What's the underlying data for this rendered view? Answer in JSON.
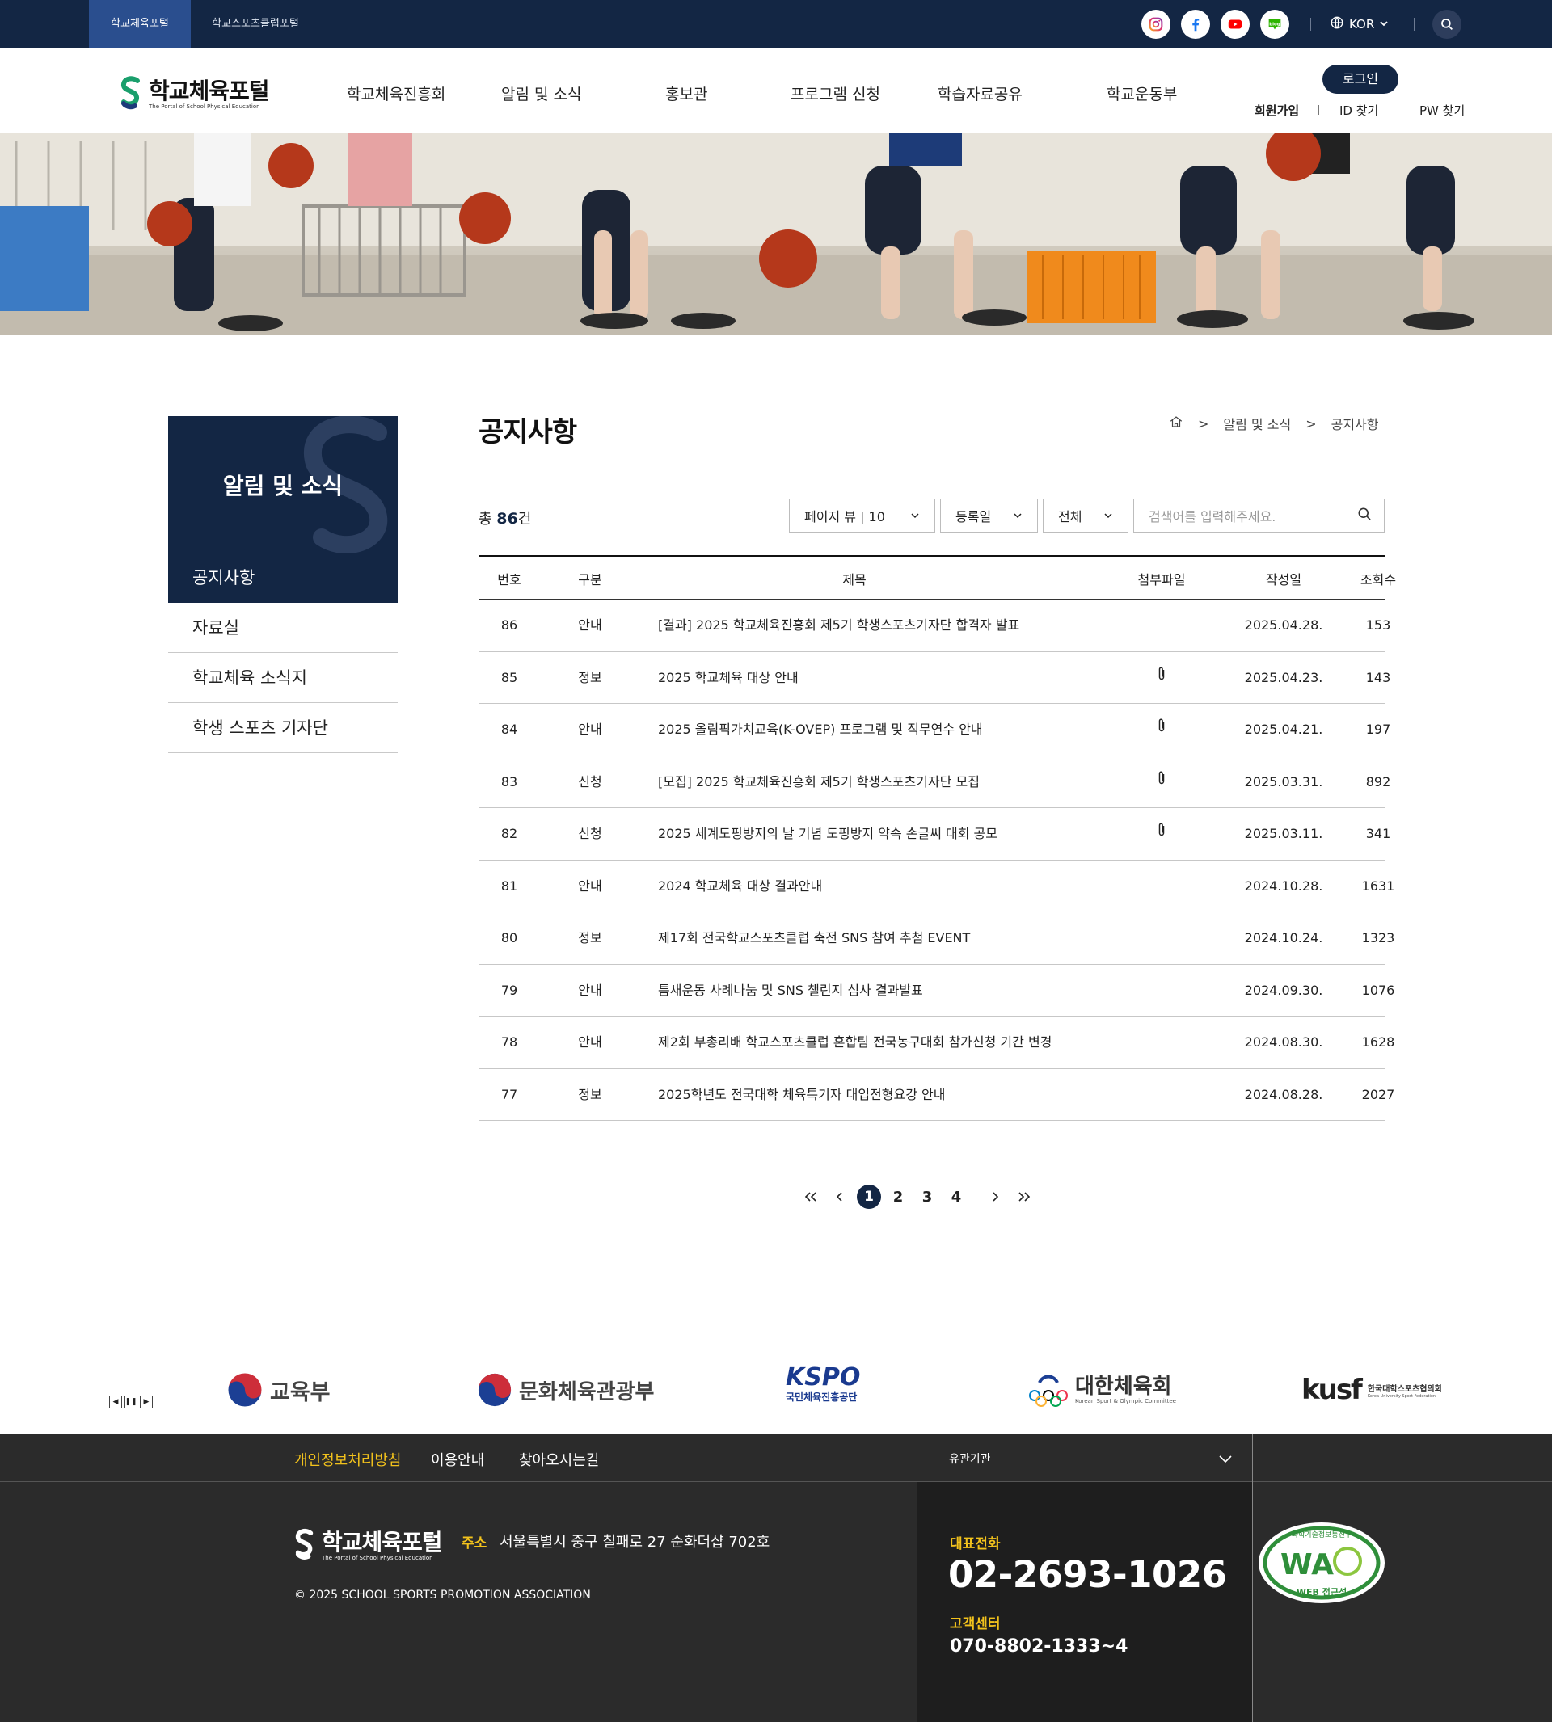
{
  "topbar": {
    "portal_tabs": [
      "학교체육포털",
      "학교스포츠클럽포털"
    ],
    "sns": [
      "instagram-icon",
      "facebook-icon",
      "youtube-icon",
      "blog-icon"
    ],
    "lang": "KOR"
  },
  "header": {
    "logo_title": "학교체육포털",
    "logo_sub": "The Portal of School Physical Education",
    "gnb": [
      "학교체육진흥회",
      "알림 및 소식",
      "홍보관",
      "프로그램 신청",
      "학습자료공유",
      "학교운동부"
    ],
    "login": "로그인",
    "util": [
      "회원가입",
      "ID 찾기",
      "PW 찾기"
    ]
  },
  "side": {
    "title": "알림 및 소식",
    "items": [
      "공지사항",
      "자료실",
      "학교체육 소식지",
      "학생 스포츠 기자단"
    ]
  },
  "content": {
    "title": "공지사항",
    "breadcrumb": [
      "알림 및 소식",
      "공지사항"
    ],
    "total_prefix": "총",
    "total_count": "86",
    "total_suffix": "건",
    "filters": {
      "page_view": "페이지 뷰  |  10",
      "sort": "등록일",
      "category": "전체",
      "search_placeholder": "검색어를 입력해주세요."
    },
    "columns": [
      "번호",
      "구분",
      "제목",
      "첨부파일",
      "작성일",
      "조회수"
    ],
    "rows": [
      {
        "no": "86",
        "cat": "안내",
        "title": "[결과] 2025 학교체육진흥회 제5기 학생스포츠기자단 합격자 발표",
        "file": false,
        "date": "2025.04.28.",
        "views": "153"
      },
      {
        "no": "85",
        "cat": "정보",
        "title": "2025 학교체육 대상 안내",
        "file": true,
        "date": "2025.04.23.",
        "views": "143"
      },
      {
        "no": "84",
        "cat": "안내",
        "title": "2025 올림픽가치교육(K-OVEP) 프로그램 및 직무연수 안내",
        "file": true,
        "date": "2025.04.21.",
        "views": "197"
      },
      {
        "no": "83",
        "cat": "신청",
        "title": "[모집] 2025 학교체육진흥회 제5기 학생스포츠기자단 모집",
        "file": true,
        "date": "2025.03.31.",
        "views": "892"
      },
      {
        "no": "82",
        "cat": "신청",
        "title": "2025 세계도핑방지의 날 기념 도핑방지 약속 손글씨 대회 공모",
        "file": true,
        "date": "2025.03.11.",
        "views": "341"
      },
      {
        "no": "81",
        "cat": "안내",
        "title": "2024 학교체육 대상 결과안내",
        "file": false,
        "date": "2024.10.28.",
        "views": "1631"
      },
      {
        "no": "80",
        "cat": "정보",
        "title": "제17회 전국학교스포츠클럽 축전 SNS 참여 추첨 EVENT",
        "file": false,
        "date": "2024.10.24.",
        "views": "1323"
      },
      {
        "no": "79",
        "cat": "안내",
        "title": "틈새운동 사례나눔 및 SNS 챌린지 심사 결과발표",
        "file": false,
        "date": "2024.09.30.",
        "views": "1076"
      },
      {
        "no": "78",
        "cat": "안내",
        "title": "제2회 부총리배 학교스포츠클럽 혼합팀 전국농구대회 참가신청 기간 변경",
        "file": false,
        "date": "2024.08.30.",
        "views": "1628"
      },
      {
        "no": "77",
        "cat": "정보",
        "title": "2025학년도 전국대학 체육특기자 대입전형요강 안내",
        "file": false,
        "date": "2024.08.28.",
        "views": "2027"
      }
    ],
    "pages": [
      "1",
      "2",
      "3",
      "4"
    ],
    "current_page": "1"
  },
  "partners": {
    "items": [
      "교육부",
      "문화체육관광부",
      "KSPO",
      "국민체육진흥공단",
      "대한체육회",
      "Korean Sport & Olympic Committee",
      "kusf",
      "한국대학스포츠협의회",
      "Korea University Sport Federation"
    ]
  },
  "footer": {
    "nav": [
      "개인정보처리방침",
      "이용안내",
      "찾아오시는길"
    ],
    "family_label": "유관기관",
    "logo_title": "학교체육포털",
    "logo_sub": "The Portal of School Physical Education",
    "addr_label": "주소",
    "addr": "서울특별시 중구 칠패로 27 순화더샵 702호",
    "copyright": "© 2025 SCHOOL SPORTS PROMOTION ASSOCIATION",
    "tel_label": "대표전화",
    "tel": "02-2693-1026",
    "cs_label": "고객센터",
    "cs": "070-8802-1333~4",
    "wa_top": "과학기술정보통신부",
    "wa_mark": "WA",
    "wa_bottom": "WEB 접근성"
  },
  "colors": {
    "navy": "#132644",
    "accent_yellow": "#f2c21c",
    "footer_bg": "#2b2b2b",
    "footer_dark": "#1e1e1e"
  }
}
